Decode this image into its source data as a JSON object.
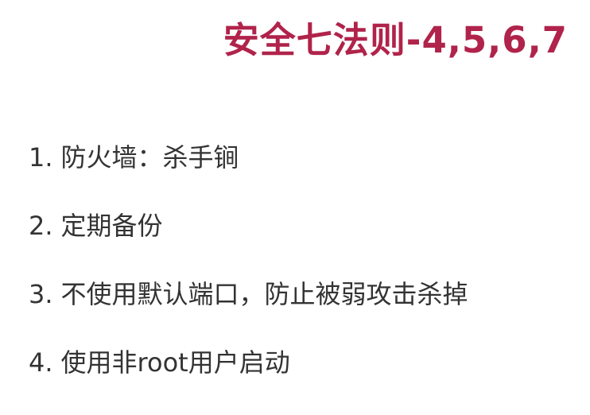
{
  "slide": {
    "title": "安全七法则-4,5,6,7",
    "items": [
      {
        "number": "1.",
        "text": "防火墙：杀手锏"
      },
      {
        "number": "2.",
        "text": "定期备份"
      },
      {
        "number": "3.",
        "text": "不使用默认端口，防止被弱攻击杀掉"
      },
      {
        "number": "4.",
        "text": "使用非root用户启动"
      }
    ]
  }
}
